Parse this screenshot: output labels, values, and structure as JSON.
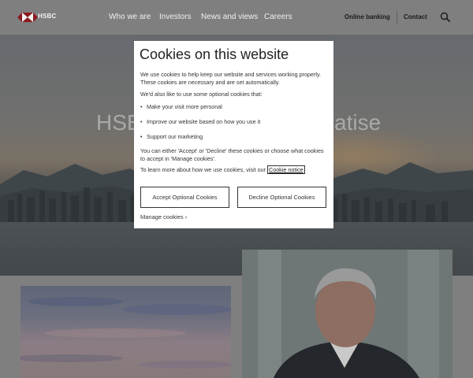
{
  "header": {
    "logo_text": "HSBC",
    "nav": [
      "Who we are",
      "Investors",
      "News and views",
      "Careers"
    ],
    "online_banking": "Online banking",
    "contact": "Contact"
  },
  "hero": {
    "title_start": "HSB",
    "title_end": "atise"
  },
  "cookie_dialog": {
    "title": "Cookies on this website",
    "intro": "We use cookies to help keep our website and services working properly. These cookies are necessary and are set automatically.",
    "optional_intro": "We'd also like to use some optional cookies that:",
    "bullets": [
      "Make your visit more personal",
      "Improve our website based on how you use it",
      "Support our marketing"
    ],
    "choice_text": "You can either 'Accept' or 'Decline' these cookies or choose what cookies to accept in 'Manage cookies'.",
    "learn_more_text": "To learn more about how we use cookies, visit our ",
    "notice_link": "Cookie notice",
    "accept_label": "Accept Optional Cookies",
    "decline_label": "Decline Optional Cookies",
    "manage_label": "Manage cookies",
    "manage_chevron": "›"
  },
  "colors": {
    "brand_red": "#db0011",
    "overlay": "#7f7f7f",
    "dialog_bg": "#ffffff"
  }
}
